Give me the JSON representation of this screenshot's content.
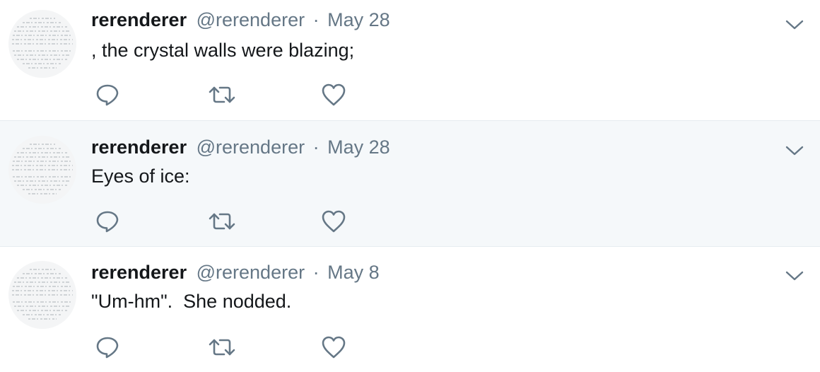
{
  "colors": {
    "name": "#14171a",
    "meta": "#657786",
    "icon": "#657786",
    "highlight_bg": "#f5f8fa",
    "divider": "#e6ecf0"
  },
  "icons": {
    "reply": "reply-icon",
    "retweet": "retweet-icon",
    "like": "heart-icon",
    "more": "chevron-down-icon"
  },
  "tweets": [
    {
      "name": "rerenderer",
      "handle": "@rerenderer",
      "separator": "·",
      "date": "May 28",
      "text": ", the crystal walls were blazing;"
    },
    {
      "name": "rerenderer",
      "handle": "@rerenderer",
      "separator": "·",
      "date": "May 28",
      "text": "Eyes of ice:"
    },
    {
      "name": "rerenderer",
      "handle": "@rerenderer",
      "separator": "·",
      "date": "May 8",
      "text": "\"Um-hm\".  She nodded."
    }
  ]
}
